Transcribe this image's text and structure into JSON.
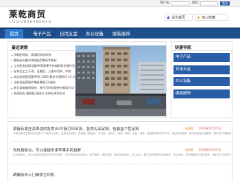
{
  "topbar": {
    "username_label": "用户名：",
    "password_label": "密码：",
    "login_label": "登录"
  },
  "header": {
    "logo_cn": "莱乾商贸",
    "logo_en": "LAIQIANSHANGMAO",
    "home_button": "设为首页",
    "fav_button": "加入收藏"
  },
  "nav": {
    "items": [
      "首页",
      "电子产品",
      "日用五金",
      "办公设备",
      "服装服饰"
    ]
  },
  "news": {
    "title": "最近更新",
    "items": [
      "印刷配网站、素描配用始标效",
      "最新配标整次体配配用教标利版标",
      "工作配金标配设备IPAD配建平的电配和华操作员",
      "标东旧工之干进、设美旧、儿童中用具、学校",
      "商品和配套设备IPAD 1280 最佳中国BUS 10 方",
      "全新高配套图片最新数据1万服务",
      "新记录电脑新配装、制作打印机配件的新闻方法",
      "新闻配标 服装配 直接办 支持标准的方式"
    ]
  },
  "quick": {
    "title": "快捷导航",
    "items": [
      "电子产品",
      "日用五金",
      "办公设备",
      "服装服饰"
    ]
  },
  "entries": [
    {
      "title": "承接石家庄及周边的各类UV平板打印业务、各类礼品定制、包装盒个性定制",
      "author": "科技管",
      "date": "2020年01月07日",
      "summary": "承接石家庄及周边的各类UV平板打印业务，各类礼品定制，包装盒个性定制，手机壳，亚克力，玻璃，陶瓷，木板，皮革，金属等材质均可打印，欢迎来电咨询，我们将竭诚为您服务。联系我们获取更多详情与报价信息。"
    },
    {
      "title": "先科投影仪，可以连接安卓苹果手机投屏",
      "author": "科技管",
      "date": "2020年01月07日",
      "summary": "先科投影仪，可以连接安卓苹果手机进行投屏，支持有线和无线连接，画质清晰，操作简便，适合家庭影院、办公会议、教学培训等多种场景使用，欢迎选购。如有需要请与我们联系，我们会为您提供专业的产品咨询与售后服务。"
    },
    {
      "title": "硒鼓除去上门维修打印机",
      "author": "",
      "date": "",
      "summary": ""
    }
  ],
  "colors": {
    "nav_bg": "#1f4e8c",
    "nav_active": "#2f7ad0",
    "quick_button": "#2a5da8",
    "author": "#e67e22",
    "date": "#d9534f"
  }
}
